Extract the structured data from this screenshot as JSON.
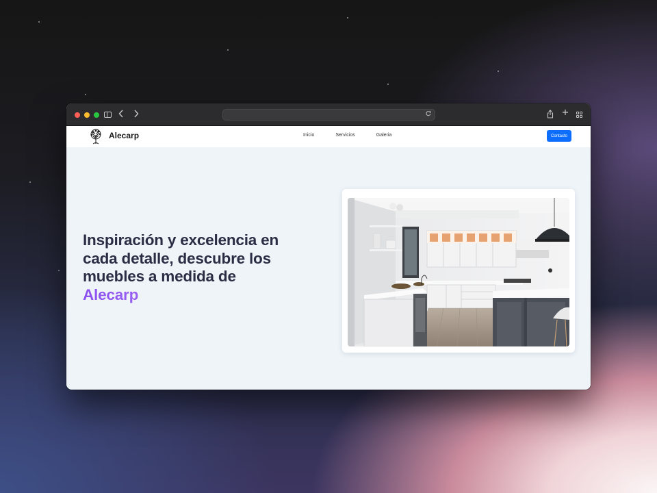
{
  "browser": {
    "url": "",
    "icons": [
      "sidebar-icon",
      "back-icon",
      "forward-icon",
      "reload-icon",
      "share-icon",
      "new-tab-icon",
      "tab-overview-icon"
    ]
  },
  "site": {
    "brand": "Alecarp",
    "nav": [
      "Inicio",
      "Servicios",
      "Galeria"
    ],
    "contact_label": "Contacto",
    "accent_color": "#0d6efd"
  },
  "hero": {
    "headline_lines": [
      "Inspiración y excelencia en",
      "cada detalle, descubre los",
      "muebles a medida de"
    ],
    "brand_highlight": "Alecarp",
    "image_alt": "kitchen-photo"
  }
}
